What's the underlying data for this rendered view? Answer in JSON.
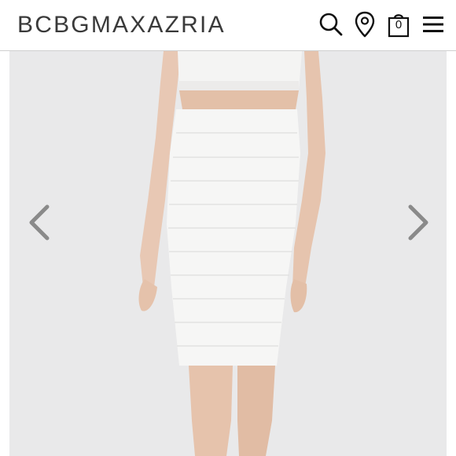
{
  "header": {
    "brand": "BCBGMAXAZRIA",
    "bag_count": "0"
  },
  "icons": {
    "search": "search-icon",
    "location": "location-pin-icon",
    "bag": "shopping-bag-icon",
    "menu": "hamburger-menu-icon",
    "prev": "chevron-left-icon",
    "next": "chevron-right-icon"
  },
  "colors": {
    "brand_text": "#3a3a3a",
    "icon": "#111111",
    "arrow": "#8a8a8a",
    "photo_background": "#e9e9ea"
  }
}
